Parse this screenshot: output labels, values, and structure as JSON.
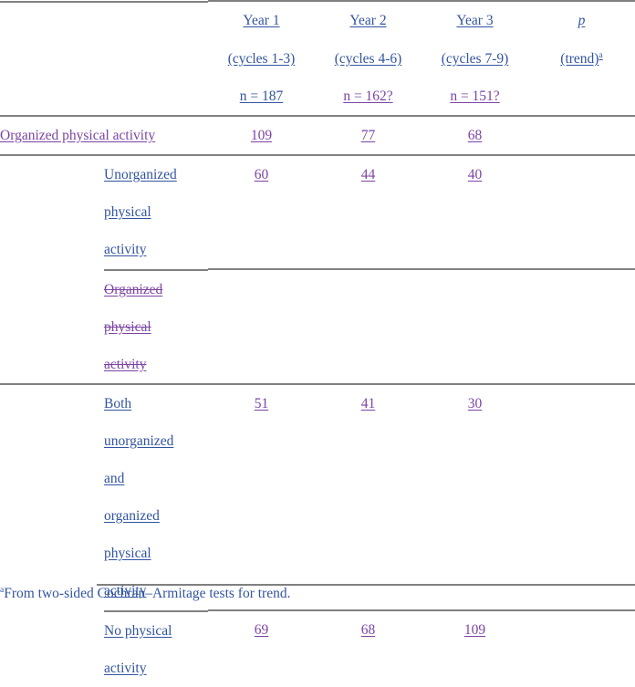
{
  "document": {
    "type": "statistical-table",
    "colors": {
      "blue": "#32549f",
      "purple": "#7c44a4",
      "rule": "#808080",
      "background": "#ffffff"
    },
    "columns": [
      {
        "id": "label",
        "header_line1": "",
        "header_line2": "",
        "header_line3": ""
      },
      {
        "id": "year1",
        "header_line1": "Year 1",
        "header_line2": "(cycles 1-3)",
        "header_line3": "n = 187"
      },
      {
        "id": "year2",
        "header_line1": "Year 2",
        "header_line2": "(cycles 4-6)",
        "header_line3": "n = 162?"
      },
      {
        "id": "year3",
        "header_line1": "Year 3",
        "header_line2": "(cycles 7-9)",
        "header_line3": "n = 151?"
      },
      {
        "id": "ptrend",
        "header_line1": "p",
        "header_line2": "(trend)",
        "header_line3": ""
      }
    ],
    "header": {
      "year1": {
        "title": "Year 1",
        "cycles": "(cycles 1-3)",
        "n": "n = 187"
      },
      "year2": {
        "title": "Year 2",
        "cycles": "(cycles 4-6)",
        "n": "n = 162?"
      },
      "year3": {
        "title": "Year 3",
        "cycles": "(cycles 7-9)",
        "n": "n = 151?"
      },
      "ptrend": {
        "title": "p",
        "sub": "(trend)",
        "superscript": "a"
      }
    },
    "rows": [
      {
        "label": "Organized physical activity",
        "label_style": "underline",
        "label_color": "purple",
        "indent": false,
        "year1": "109",
        "year2": "77",
        "year3": "68",
        "ptrend": ""
      },
      {
        "label_lines": [
          "Unorganized ",
          "physical ",
          "activity"
        ],
        "label_style": "underline",
        "label_color": "blue",
        "indent": true,
        "year1": "60",
        "year2": "44",
        "year3": "40",
        "ptrend": ""
      },
      {
        "label_lines": [
          "Organized ",
          "physical ",
          "activity"
        ],
        "label_style": "strikethrough-underline",
        "label_color": "purple",
        "indent": true,
        "year1": "",
        "year2": "",
        "year3": "",
        "ptrend": ""
      },
      {
        "label_lines": [
          "Both ",
          "unorganized ",
          "and ",
          "organized ",
          "physical ",
          "activity"
        ],
        "label_style": "underline",
        "label_color": "blue",
        "indent": true,
        "year1": "51",
        "year2": "41",
        "year3": "30",
        "ptrend": ""
      },
      {
        "label_lines": [
          "No physical ",
          "activity"
        ],
        "label_style": "underline",
        "label_color": "blue",
        "indent": true,
        "year1": "69",
        "year2": "68",
        "year3": "109",
        "ptrend": ""
      }
    ],
    "footnote": {
      "marker": "a",
      "text": "From two-sided Cochran–Armitage tests for trend."
    }
  }
}
